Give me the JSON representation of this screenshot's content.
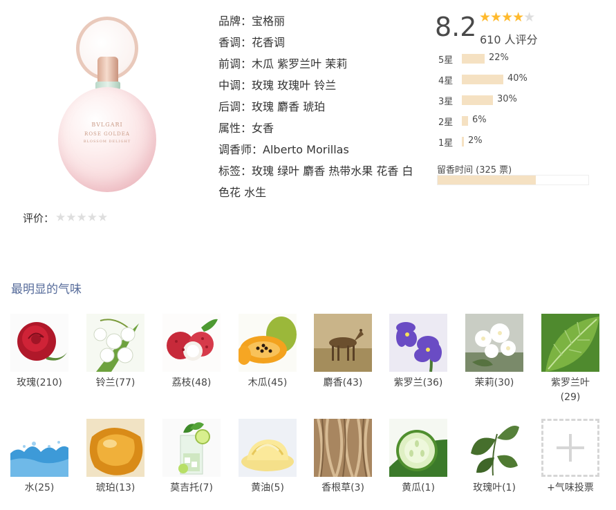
{
  "product": {
    "label_brand": "BVLGARI",
    "label_name": "ROSE GOLDEA",
    "label_sub": "BLOSSOM DELIGHT"
  },
  "user_rating": {
    "label": "评价：",
    "stars": "★★★★★"
  },
  "attributes": [
    {
      "key": "品牌",
      "value": "宝格丽"
    },
    {
      "key": "香调",
      "value": "花香调"
    },
    {
      "key": "前调",
      "value": "木瓜 紫罗兰叶 茉莉"
    },
    {
      "key": "中调",
      "value": "玫瑰 玫瑰叶 铃兰"
    },
    {
      "key": "后调",
      "value": "玫瑰 麝香 琥珀"
    },
    {
      "key": "属性",
      "value": "女香"
    },
    {
      "key": "调香师",
      "value": "Alberto Morillas"
    },
    {
      "key": "标签",
      "value": "玫瑰 绿叶 麝香 热带水果 花香 白色花 水生"
    }
  ],
  "score": {
    "value": "8.2",
    "stars_on": "★★★★",
    "stars_off": "★",
    "count_text": "610 人评分"
  },
  "distribution": [
    {
      "label": "5星",
      "pct": 22,
      "text": "22%"
    },
    {
      "label": "4星",
      "pct": 40,
      "text": "40%"
    },
    {
      "label": "3星",
      "pct": 30,
      "text": "30%"
    },
    {
      "label": "2星",
      "pct": 6,
      "text": "6%"
    },
    {
      "label": "1星",
      "pct": 2,
      "text": "2%"
    }
  ],
  "sillage": {
    "label": "留香时间 (325 票)",
    "fill_pct": 65
  },
  "notes": {
    "title": "最明显的气味",
    "items": [
      {
        "id": "rose",
        "label": "玫瑰(210)",
        "icon": "rose-icon"
      },
      {
        "id": "lily-of-the-valley",
        "label": "铃兰(77)",
        "icon": "lily-of-the-valley-icon"
      },
      {
        "id": "lychee",
        "label": "荔枝(48)",
        "icon": "lychee-icon"
      },
      {
        "id": "papaya",
        "label": "木瓜(45)",
        "icon": "papaya-icon"
      },
      {
        "id": "musk",
        "label": "麝香(43)",
        "icon": "musk-deer-icon"
      },
      {
        "id": "violet",
        "label": "紫罗兰(36)",
        "icon": "violet-icon"
      },
      {
        "id": "jasmine",
        "label": "茉莉(30)",
        "icon": "jasmine-icon"
      },
      {
        "id": "violet-leaf",
        "label": "紫罗兰叶\n(29)",
        "icon": "violet-leaf-icon"
      },
      {
        "id": "water",
        "label": "水(25)",
        "icon": "water-splash-icon"
      },
      {
        "id": "amber",
        "label": "琥珀(13)",
        "icon": "amber-icon"
      },
      {
        "id": "mojito",
        "label": "莫吉托(7)",
        "icon": "mojito-icon"
      },
      {
        "id": "butter",
        "label": "黄油(5)",
        "icon": "butter-icon"
      },
      {
        "id": "vetiver",
        "label": "香根草(3)",
        "icon": "vetiver-root-icon"
      },
      {
        "id": "cucumber",
        "label": "黄瓜(1)",
        "icon": "cucumber-icon"
      },
      {
        "id": "rose-leaf",
        "label": "玫瑰叶(1)",
        "icon": "rose-leaf-icon"
      }
    ],
    "vote_label": "+气味投票"
  }
}
